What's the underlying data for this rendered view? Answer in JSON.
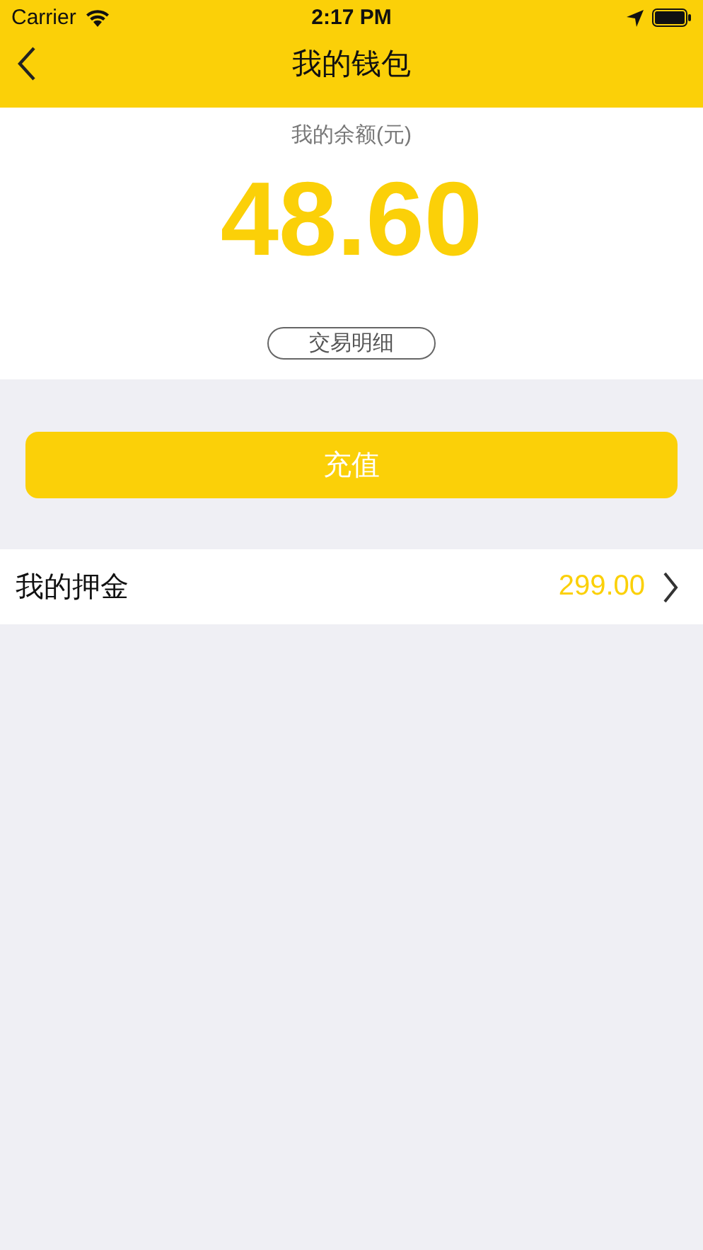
{
  "status_bar": {
    "carrier": "Carrier",
    "time": "2:17 PM"
  },
  "nav": {
    "title": "我的钱包"
  },
  "balance": {
    "label": "我的余额(元)",
    "amount": "48.60",
    "details_button": "交易明细"
  },
  "recharge_button": "充值",
  "deposit": {
    "label": "我的押金",
    "amount": "299.00"
  }
}
